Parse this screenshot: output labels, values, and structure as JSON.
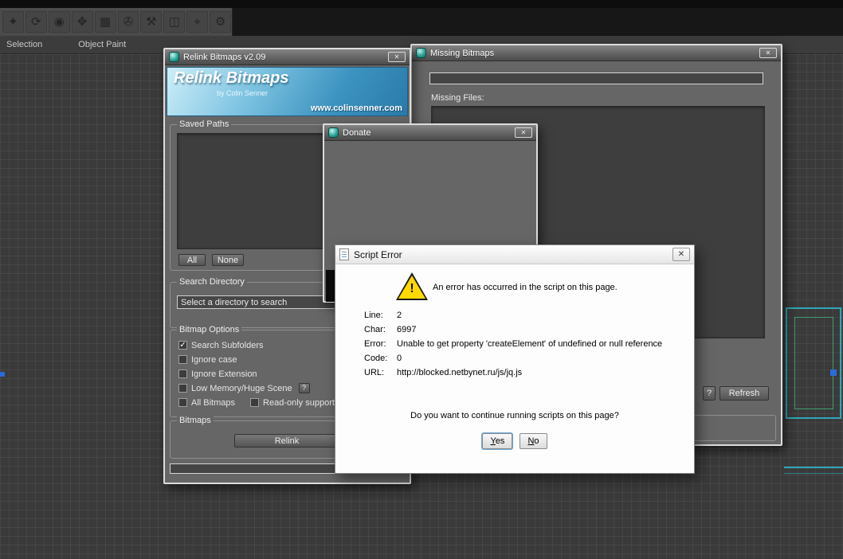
{
  "toolbar": {
    "tabs": [
      "Selection",
      "Object Paint"
    ],
    "icons": [
      {
        "name": "select-figure-icon",
        "glyph": "✦"
      },
      {
        "name": "rotate-icon",
        "glyph": "⟳"
      },
      {
        "name": "sphere-icon",
        "glyph": "◉"
      },
      {
        "name": "move-icon",
        "glyph": "✥"
      },
      {
        "name": "grid-array-icon",
        "glyph": "▦"
      },
      {
        "name": "film-icon",
        "glyph": "✇"
      },
      {
        "name": "link-icon",
        "glyph": "⚒"
      },
      {
        "name": "mirror-icon",
        "glyph": "◫"
      },
      {
        "name": "target-icon",
        "glyph": "⌖"
      },
      {
        "name": "light-icon",
        "glyph": "⚙"
      }
    ]
  },
  "relink_dialog": {
    "title": "Relink Bitmaps v2.09",
    "banner": {
      "title": "Relink Bitmaps",
      "subtitle": "by Colin Senner",
      "url": "www.colinsenner.com"
    },
    "saved_paths_label": "Saved Paths",
    "all_button": "All",
    "none_button": "None",
    "search_directory_label": "Search Directory",
    "search_input_value": "Select a directory to search",
    "bitmap_options_label": "Bitmap Options",
    "options": [
      {
        "label": "Search Subfolders",
        "checked": true
      },
      {
        "label": "Ignore case",
        "checked": false
      },
      {
        "label": "Ignore Extension",
        "checked": false
      },
      {
        "label": "Low Memory/Huge Scene",
        "checked": false
      },
      {
        "label": "All Bitmaps",
        "checked": false
      },
      {
        "label": "Read-only support",
        "checked": false
      }
    ],
    "low_memory_help_button": "?",
    "bitmaps_label": "Bitmaps",
    "relink_button": "Relink"
  },
  "missing_dialog": {
    "title": "Missing Bitmaps",
    "missing_files_label": "Missing Files:",
    "help_button": "?",
    "refresh_button": "Refresh"
  },
  "donate_dialog": {
    "title": "Donate"
  },
  "script_error_dialog": {
    "title": "Script Error",
    "message": "An error has occurred in the script on this page.",
    "fields": [
      {
        "label": "Line:",
        "value": "2"
      },
      {
        "label": "Char:",
        "value": "6997"
      },
      {
        "label": "Error:",
        "value": "Unable to get property 'createElement' of undefined or null reference"
      },
      {
        "label": "Code:",
        "value": "0"
      },
      {
        "label": "URL:",
        "value": "http://blocked.netbynet.ru/js/jq.js"
      }
    ],
    "question": "Do you want to continue running scripts on this page?",
    "yes_button": "Yes",
    "no_button": "No"
  },
  "colors": {
    "viewport_wire": "#2fa7b8",
    "warning_yellow": "#ffd900",
    "banner_blue": "#3c93c0"
  }
}
